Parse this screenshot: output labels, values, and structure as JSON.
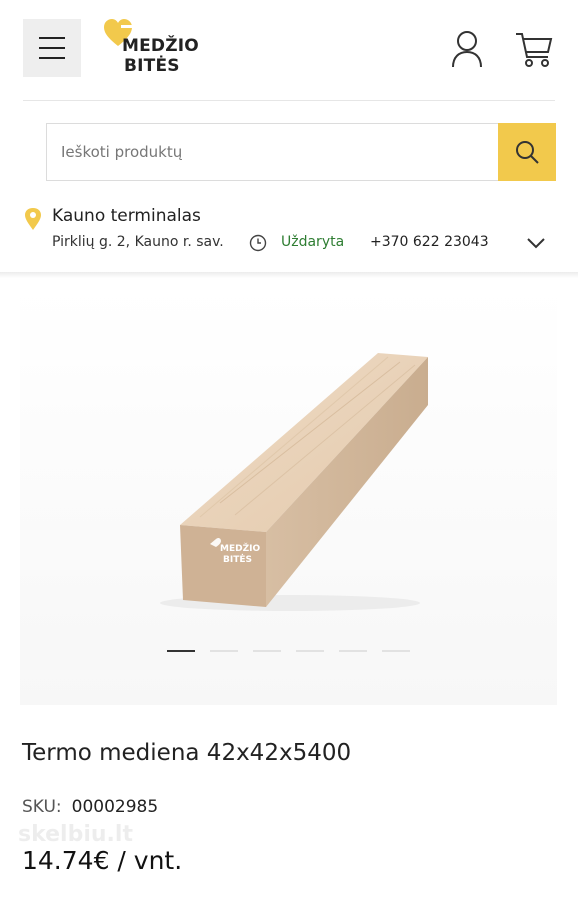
{
  "brand": {
    "line1": "MEDŽIO",
    "line2": "BITĖS",
    "accent_color": "#f2c94c"
  },
  "header": {
    "menu_icon": "hamburger-icon",
    "account_icon": "user-icon",
    "cart_icon": "cart-icon"
  },
  "search": {
    "placeholder": "Ieškoti produktų",
    "button_icon": "search-icon"
  },
  "store": {
    "name": "Kauno terminalas",
    "address": "Pirklių g. 2, Kauno r. sav.",
    "status": "Uždaryta",
    "status_color": "#2e7d32",
    "phone": "+370 622 23043"
  },
  "gallery": {
    "slide_count": 6,
    "active_slide": 1,
    "image_logo_line1": "MEDŽIO",
    "image_logo_line2": "BITĖS"
  },
  "product": {
    "title": "Termo mediena 42x42x5400",
    "sku_label": "SKU:",
    "sku_value": "00002985",
    "price": "14.74€ / vnt."
  },
  "watermark_text": "skelbiu.lt"
}
